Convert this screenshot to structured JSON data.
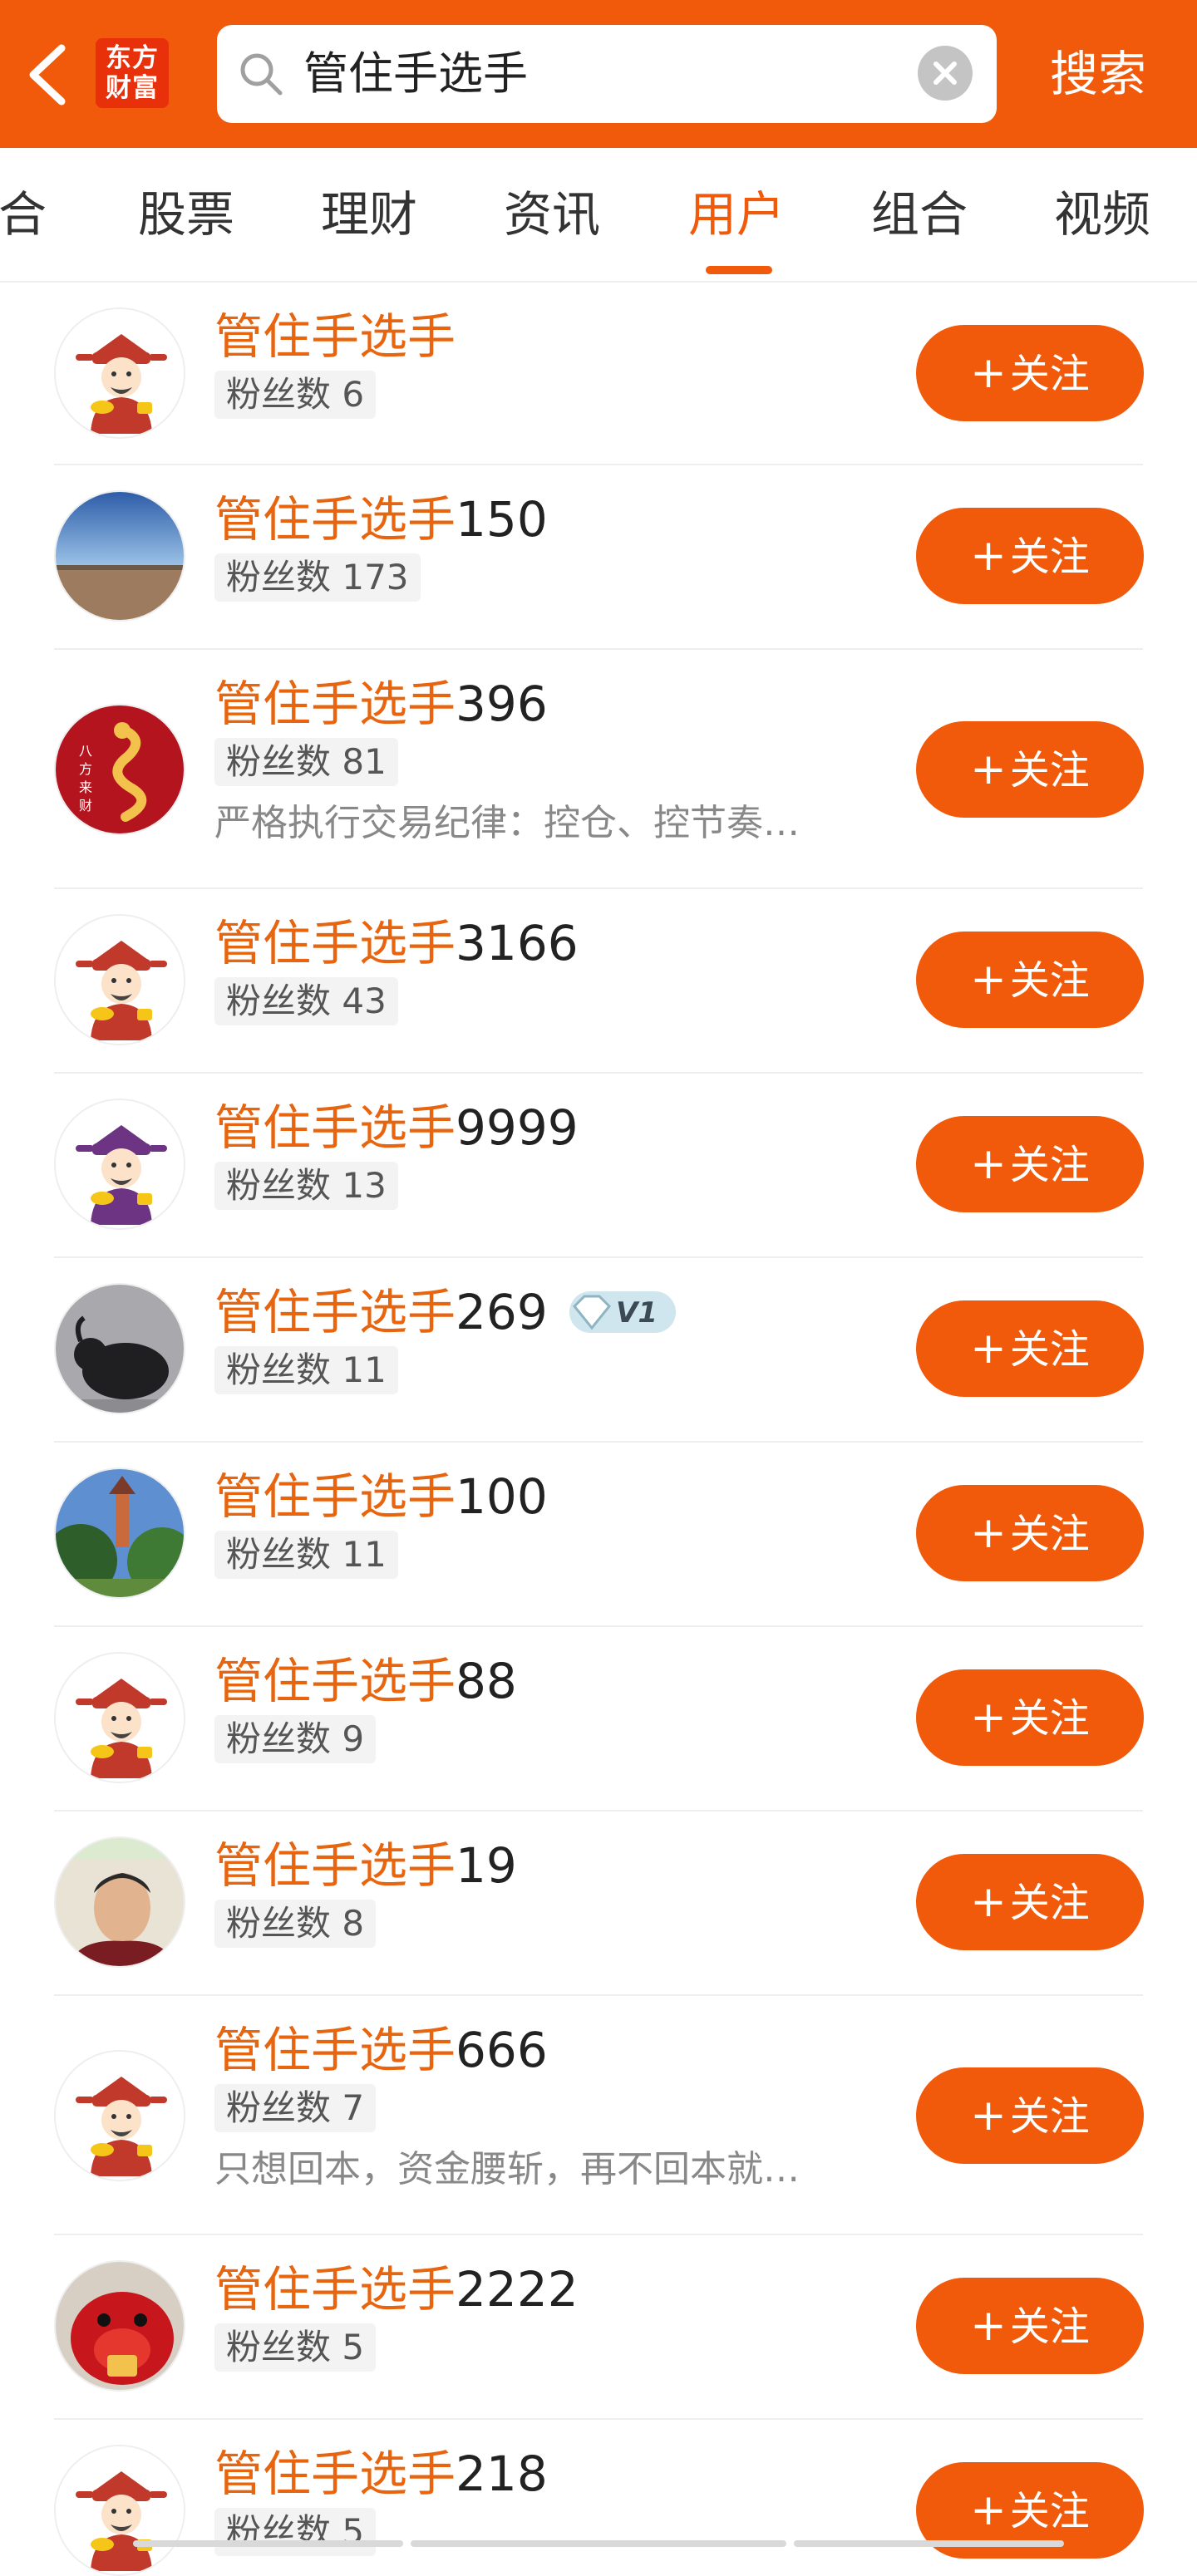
{
  "header": {
    "logo_line1": "东方",
    "logo_line2": "财富",
    "search_value": "管住手选手",
    "search_button": "搜索"
  },
  "tabs": [
    {
      "label": "综合",
      "active": false
    },
    {
      "label": "股票",
      "active": false
    },
    {
      "label": "理财",
      "active": false
    },
    {
      "label": "资讯",
      "active": false
    },
    {
      "label": "用户",
      "active": true
    },
    {
      "label": "组合",
      "active": false
    },
    {
      "label": "视频",
      "active": false
    }
  ],
  "follow_label": "关注",
  "colors": {
    "brand_orange": "#f05a0a",
    "highlight_text": "#e8650f"
  },
  "users": [
    {
      "name_highlight": "管住手选手",
      "name_suffix": "",
      "fans": "粉丝数 6",
      "bio": "",
      "avatar": "caishen-avatar",
      "badge": ""
    },
    {
      "name_highlight": "管住手选手",
      "name_suffix": "150",
      "fans": "粉丝数 173",
      "bio": "",
      "avatar": "desert-sky-avatar",
      "badge": ""
    },
    {
      "name_highlight": "管住手选手",
      "name_suffix": "396",
      "fans": "粉丝数 81",
      "bio": "严格执行交易纪律：控仓、控节奏…",
      "avatar": "red-dragon-avatar",
      "badge": ""
    },
    {
      "name_highlight": "管住手选手",
      "name_suffix": "3166",
      "fans": "粉丝数 43",
      "bio": "",
      "avatar": "caishen-avatar",
      "badge": ""
    },
    {
      "name_highlight": "管住手选手",
      "name_suffix": "9999",
      "fans": "粉丝数 13",
      "bio": "",
      "avatar": "purple-caishen-avatar",
      "badge": ""
    },
    {
      "name_highlight": "管住手选手",
      "name_suffix": "269",
      "fans": "粉丝数 11",
      "bio": "",
      "avatar": "bull-avatar",
      "badge": "V1"
    },
    {
      "name_highlight": "管住手选手",
      "name_suffix": "100",
      "fans": "粉丝数 11",
      "bio": "",
      "avatar": "garden-avatar",
      "badge": ""
    },
    {
      "name_highlight": "管住手选手",
      "name_suffix": "88",
      "fans": "粉丝数 9",
      "bio": "",
      "avatar": "caishen-avatar",
      "badge": ""
    },
    {
      "name_highlight": "管住手选手",
      "name_suffix": "19",
      "fans": "粉丝数 8",
      "bio": "",
      "avatar": "man-photo-avatar",
      "badge": ""
    },
    {
      "name_highlight": "管住手选手",
      "name_suffix": "666",
      "fans": "粉丝数 7",
      "bio": "只想回本，资金腰斩，再不回本就…",
      "avatar": "caishen-avatar",
      "badge": ""
    },
    {
      "name_highlight": "管住手选手",
      "name_suffix": "2222",
      "fans": "粉丝数 5",
      "bio": "",
      "avatar": "red-ox-avatar",
      "badge": ""
    },
    {
      "name_highlight": "管住手选手",
      "name_suffix": "218",
      "fans": "粉丝数 5",
      "bio": "",
      "avatar": "caishen-avatar",
      "badge": ""
    }
  ]
}
